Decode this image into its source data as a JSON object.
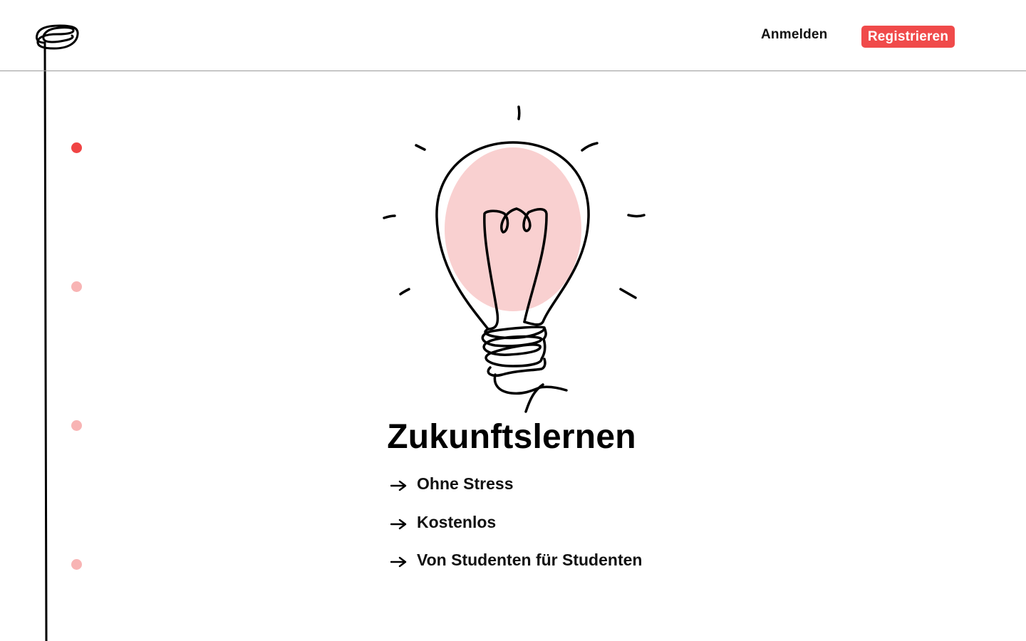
{
  "header": {
    "logo_icon": "scribble-logo-icon",
    "login_label": "Anmelden",
    "register_label": "Registrieren"
  },
  "timeline": {
    "dots": [
      {
        "state": "active"
      },
      {
        "state": "inactive"
      },
      {
        "state": "inactive"
      },
      {
        "state": "inactive"
      }
    ]
  },
  "hero": {
    "illustration_icon": "lightbulb-icon",
    "title": "Zukunftslernen",
    "features": [
      {
        "icon": "arrow-right-icon",
        "label": "Ohne Stress"
      },
      {
        "icon": "arrow-right-icon",
        "label": "Kostenlos"
      },
      {
        "icon": "arrow-right-icon",
        "label": "Von Studenten für Studenten"
      }
    ]
  },
  "colors": {
    "accent": "#f04a4a",
    "dot_active": "#f04444",
    "dot_inactive": "#f8b4b4",
    "bulb_fill": "#f9d0d0"
  }
}
